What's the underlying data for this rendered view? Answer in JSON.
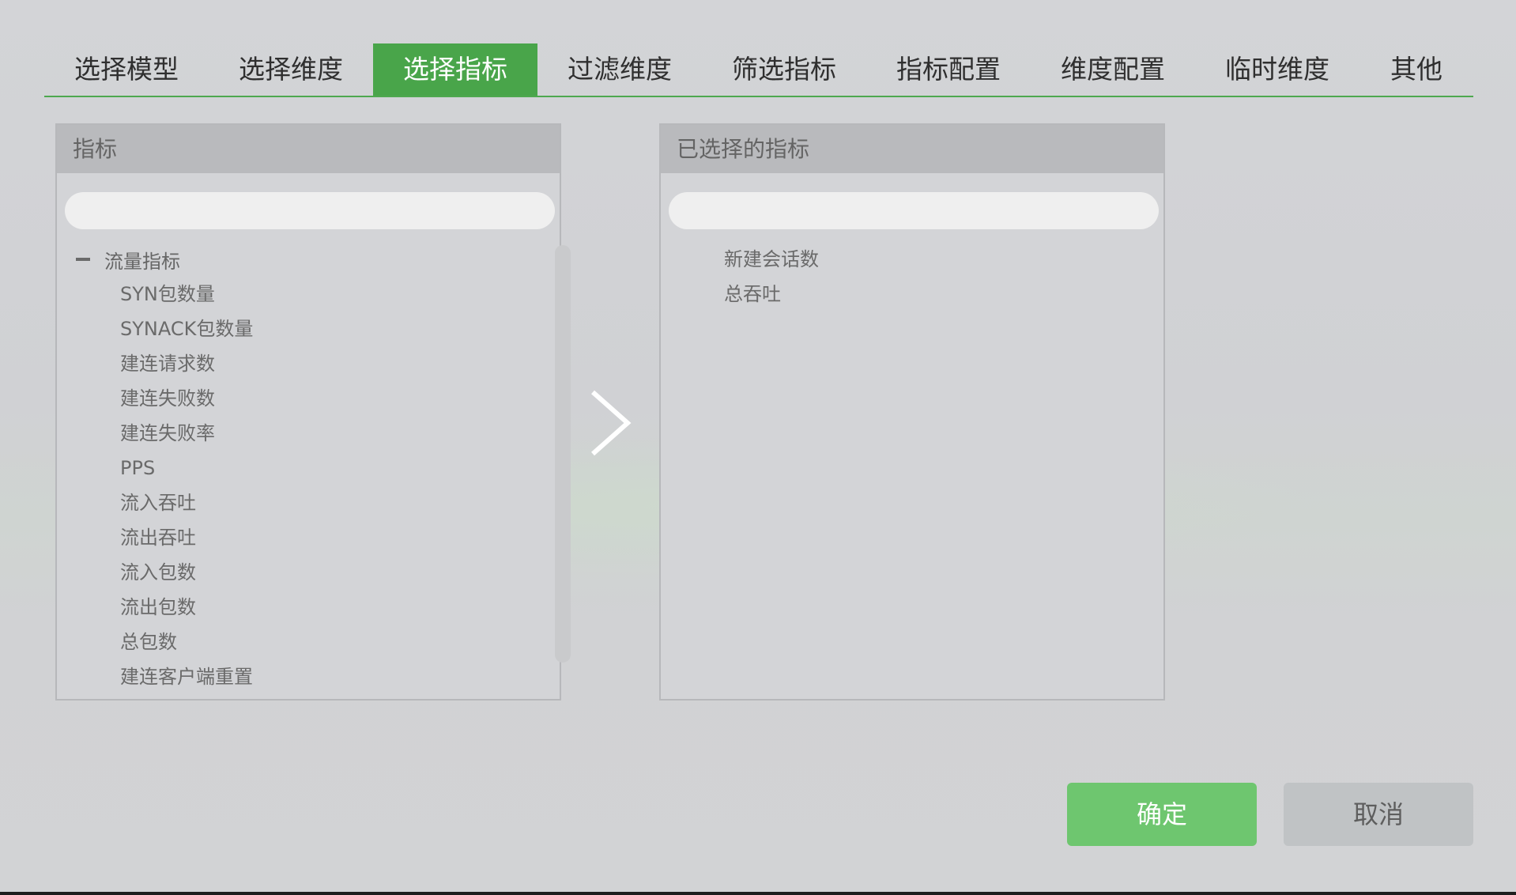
{
  "tabs": [
    {
      "label": "选择模型",
      "active": false
    },
    {
      "label": "选择维度",
      "active": false
    },
    {
      "label": "选择指标",
      "active": true
    },
    {
      "label": "过滤维度",
      "active": false
    },
    {
      "label": "筛选指标",
      "active": false
    },
    {
      "label": "指标配置",
      "active": false
    },
    {
      "label": "维度配置",
      "active": false
    },
    {
      "label": "临时维度",
      "active": false
    },
    {
      "label": "其他",
      "active": false
    }
  ],
  "left_panel": {
    "title": "指标",
    "search_value": "",
    "group": {
      "label": "流量指标",
      "expanded": true,
      "items": [
        "SYN包数量",
        "SYNACK包数量",
        "建连请求数",
        "建连失败数",
        "建连失败率",
        "PPS",
        "流入吞吐",
        "流出吞吐",
        "流入包数",
        "流出包数",
        "总包数",
        "建连客户端重置"
      ]
    }
  },
  "right_panel": {
    "title": "已选择的指标",
    "search_value": "",
    "items": [
      "新建会话数",
      "总吞吐"
    ]
  },
  "buttons": {
    "confirm": "确定",
    "cancel": "取消"
  },
  "colors": {
    "accent": "#49a54a",
    "confirm_bg": "#6ec66f",
    "cancel_bg": "#c0c3c5"
  }
}
